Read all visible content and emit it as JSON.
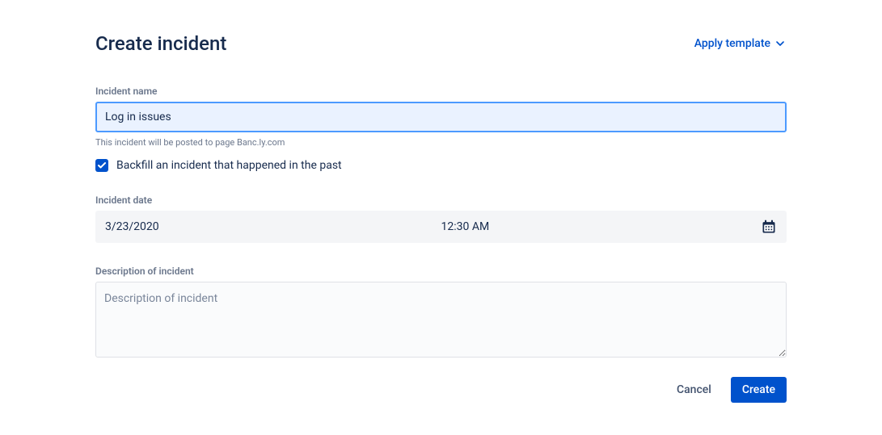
{
  "header": {
    "title": "Create incident",
    "apply_template_label": "Apply template"
  },
  "form": {
    "incident_name_label": "Incident name",
    "incident_name_value": "Log in issues",
    "incident_name_helper": "This incident will be posted to page Banc.ly.com",
    "backfill_label": "Backfill an incident that happened in the past",
    "backfill_checked": true,
    "incident_date_label": "Incident date",
    "incident_date_value": "3/23/2020",
    "incident_time_value": "12:30 AM",
    "description_label": "Description of incident",
    "description_placeholder": "Description of incident",
    "description_value": ""
  },
  "footer": {
    "cancel_label": "Cancel",
    "create_label": "Create"
  }
}
